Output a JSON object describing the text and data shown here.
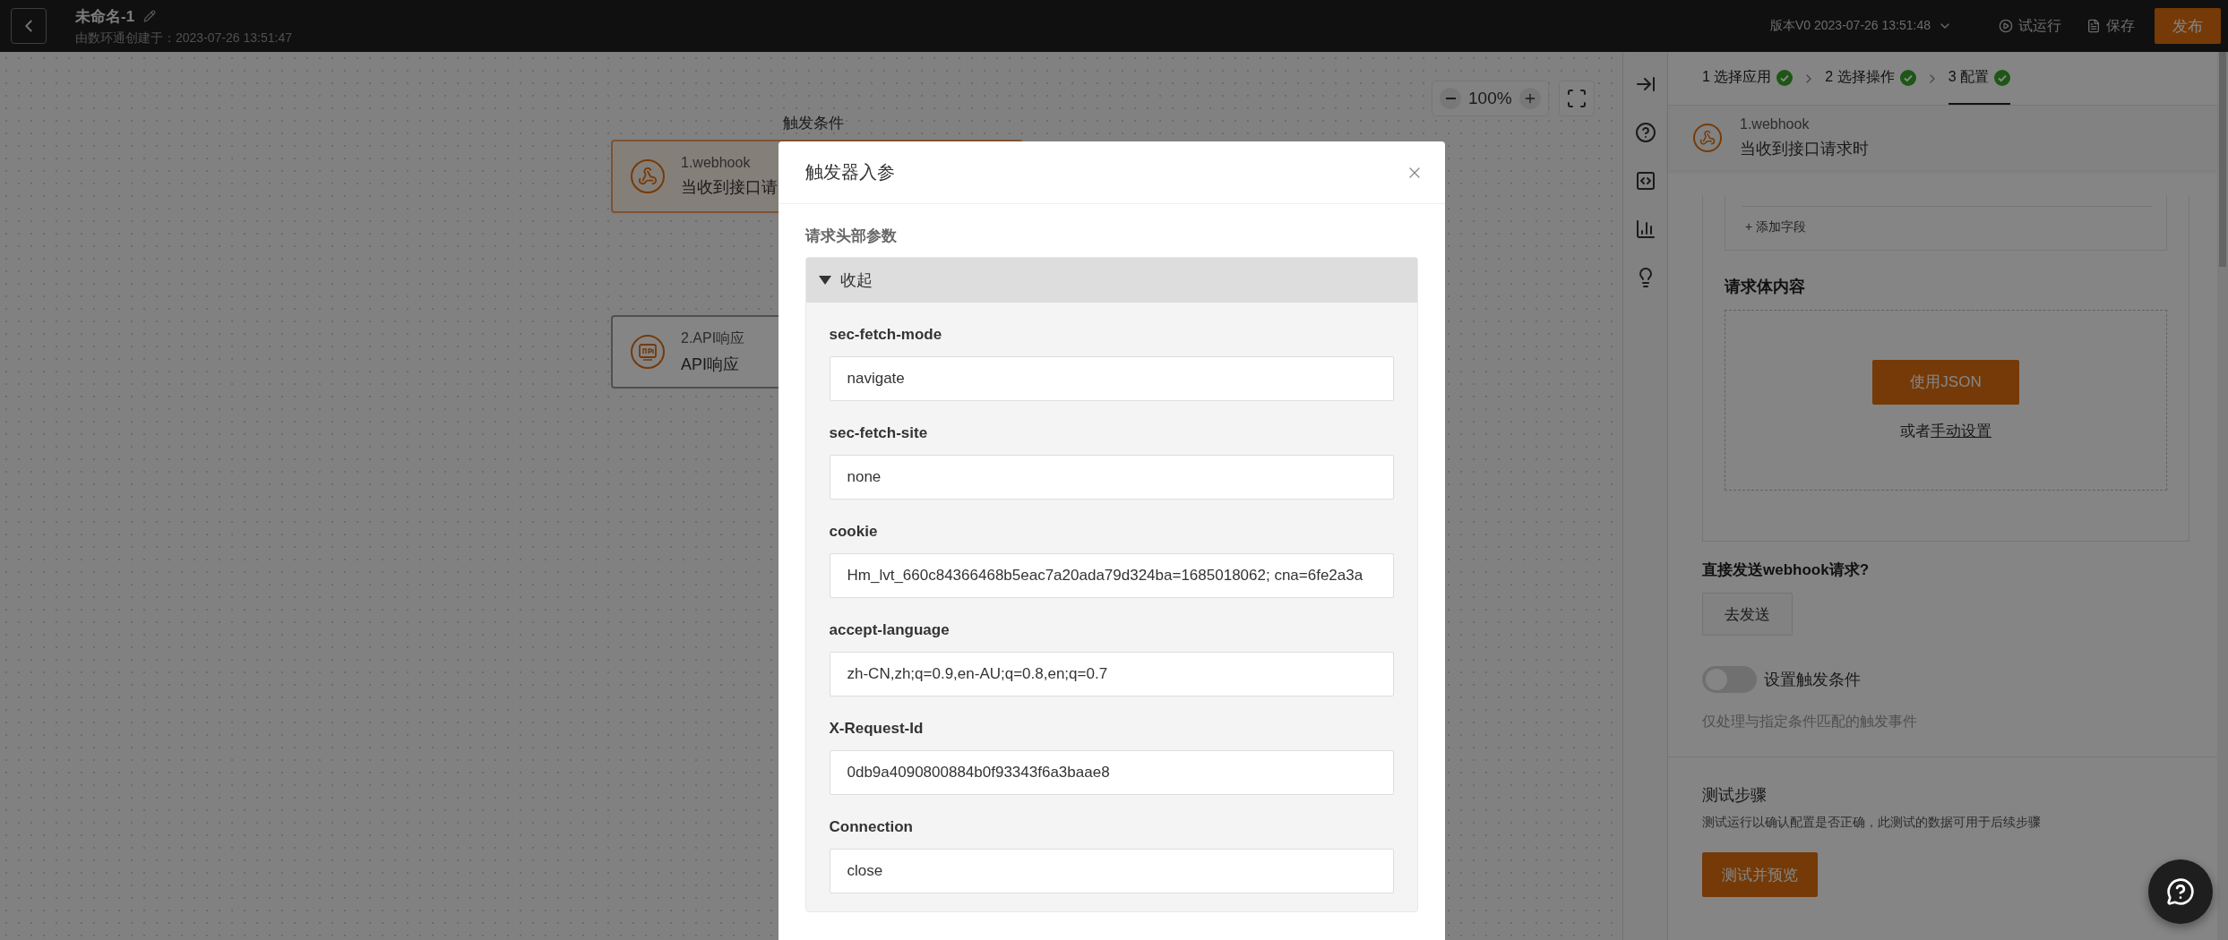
{
  "top_bar": {
    "title": "未命名-1",
    "subtitle": "由数环通创建于：2023-07-26 13:51:47",
    "version": "版本V0 2023-07-26 13:51:48",
    "actions": [
      {
        "kind": "run",
        "label": "试运行"
      },
      {
        "kind": "save",
        "label": "保存"
      },
      {
        "kind": "primary",
        "label": "发布"
      }
    ]
  },
  "canvas": {
    "zoom": "100%",
    "group_label": "触发条件",
    "nodes": [
      {
        "kind": "webhook",
        "title": "1.webhook",
        "subtitle": "当收到接口请",
        "selected": true
      },
      {
        "kind": "api",
        "title": "2.API响应",
        "subtitle": "API响应",
        "selected": false
      }
    ]
  },
  "steps": [
    {
      "label": "1 选择应用",
      "done": true,
      "selected": false
    },
    {
      "label": "2 选择操作",
      "done": true,
      "selected": false
    },
    {
      "label": "3 配置",
      "done": true,
      "selected": true
    }
  ],
  "trigger": {
    "title": "1.webhook",
    "subtitle": "当收到接口请求时"
  },
  "form": {
    "add_field": "+ 添加字段",
    "body_title": "请求体内容",
    "use_json": "使用JSON",
    "manual_prefix": "或者",
    "manual_link": "手动设置",
    "send_title": "直接发送webhook请求?",
    "send_button": "去发送",
    "condition": {
      "label": "设置触发条件",
      "on": false,
      "hint": "仅处理与指定条件匹配的触发事件"
    }
  },
  "test": {
    "title": "测试步骤",
    "description": "测试运行以确认配置是否正确，此测试的数据可用于后续步骤",
    "button": "测试并预览"
  },
  "dialog": {
    "title": "触发器入参",
    "section": "请求头部参数",
    "collapse": "收起",
    "expanded": true,
    "fields": [
      {
        "label": "sec-fetch-mode",
        "value": "navigate"
      },
      {
        "label": "sec-fetch-site",
        "value": "none"
      },
      {
        "label": "cookie",
        "value": "Hm_lvt_660c84366468b5eac7a20ada79d324ba=1685018062; cna=6fe2a3a"
      },
      {
        "label": "accept-language",
        "value": "zh-CN,zh;q=0.9,en-AU;q=0.8,en;q=0.7"
      },
      {
        "label": "X-Request-Id",
        "value": "0db9a4090800884b0f93343f6a3baae8"
      },
      {
        "label": "Connection",
        "value": "close"
      }
    ]
  }
}
